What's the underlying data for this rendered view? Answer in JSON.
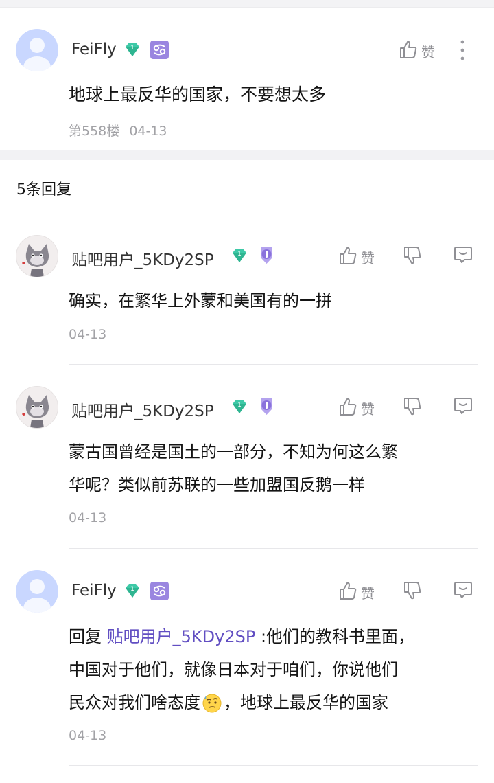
{
  "main_post": {
    "username": "FeiFly",
    "content": "地球上最反华的国家，不要想太多",
    "floor": "第558楼",
    "date": "04-13",
    "like_label": "赞",
    "level": "1"
  },
  "replies_header": "5条回复",
  "replies": [
    {
      "username": "贴吧用户_5KDy2SP",
      "level": "1",
      "lines": [
        "确实，在繁华上外蒙和美国有的一拼"
      ],
      "date": "04-13",
      "like_label": "赞"
    },
    {
      "username": "贴吧用户_5KDy2SP",
      "level": "1",
      "lines": [
        "蒙古国曾经是国土的一部分，不知为何这么繁",
        "华呢？类似前苏联的一些加盟国反鹅一样"
      ],
      "date": "04-13",
      "like_label": "赞"
    },
    {
      "username": "FeiFly",
      "level": "1",
      "reply_prefix": "回复 ",
      "reply_to": "贴吧用户_5KDy2SP",
      "line1_rest": " :他们的教科书里面，",
      "line2": "中国对于他们，就像日本对于咱们，你说他们",
      "line3_a": "民众对我们啥态度",
      "line3_b": "，地球上最反华的国家",
      "date": "04-13",
      "like_label": "赞"
    }
  ],
  "colors": {
    "accent_link": "#614ec2",
    "gem": "#3ec9a7",
    "badge_purple": "#9a86e0",
    "meta_gray": "#a2a2a6"
  },
  "icons": [
    "thumbs-up-icon",
    "thumbs-down-icon",
    "comment-icon",
    "more-vertical-icon",
    "level-gem-icon",
    "cancer-zodiac-icon",
    "rank-medal-icon"
  ]
}
